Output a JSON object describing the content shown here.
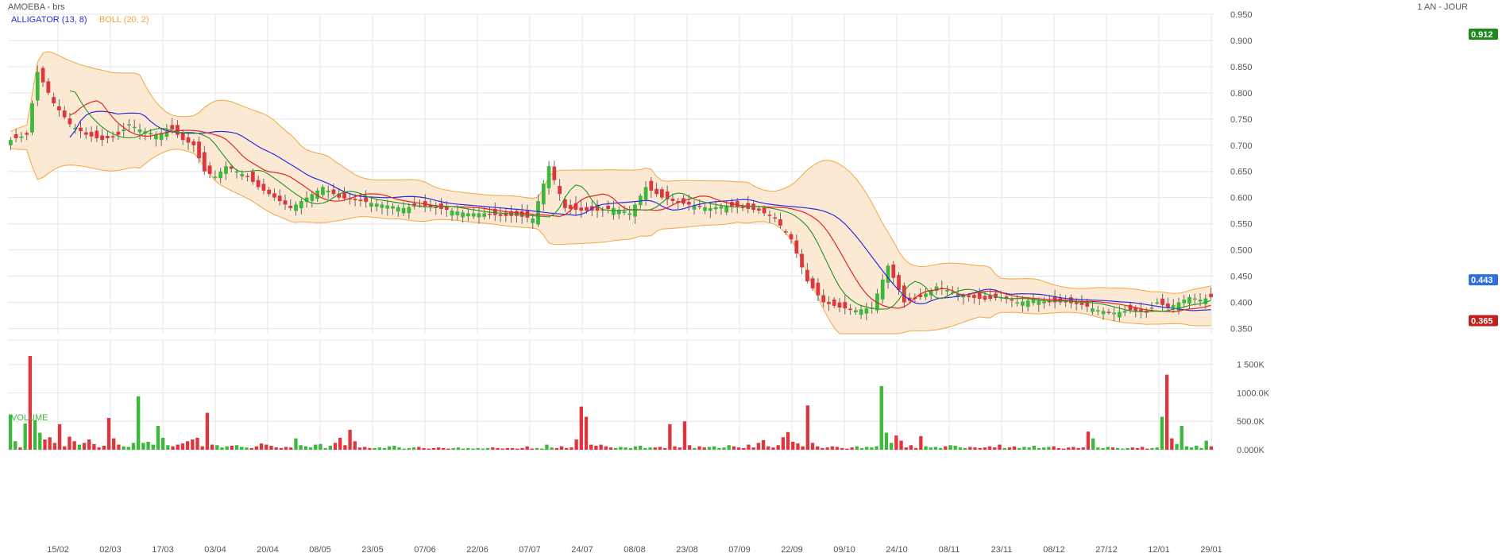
{
  "header": {
    "symbol": "AMOEBA - brs",
    "period": "1 AN - JOUR"
  },
  "indicators": {
    "alligator": "ALLIGATOR (13, 8)",
    "boll": "BOLL (20, 2)",
    "volume": "VOLUME"
  },
  "colors": {
    "up": "#3cb83c",
    "down": "#e0353f",
    "alligator_slow": "#2c2cdc",
    "alligator_mid": "#e02424",
    "alligator_fast": "#2e9a2e",
    "boll_line": "#f4a640",
    "boll_fill": "#fce5cc",
    "grid": "#e6e6e6",
    "badge_high": "#1e8a1e",
    "badge_last": "#2f6fe0",
    "badge_low": "#c41f1f"
  },
  "badges": {
    "high": "0.912",
    "last": "0.443",
    "low": "0.365"
  },
  "chart_data": [
    {
      "type": "candlestick",
      "title": "AMOEBA - brs",
      "ylim": [
        0.34,
        0.95
      ],
      "y_ticks": [
        "0.950",
        "0.900",
        "0.850",
        "0.800",
        "0.750",
        "0.700",
        "0.650",
        "0.600",
        "0.550",
        "0.500",
        "0.450",
        "0.400",
        "0.350"
      ],
      "x_ticks": [
        "15/02",
        "02/03",
        "17/03",
        "03/04",
        "20/04",
        "08/05",
        "23/05",
        "07/06",
        "22/06",
        "07/07",
        "24/07",
        "08/08",
        "23/08",
        "07/09",
        "22/09",
        "09/10",
        "24/10",
        "08/11",
        "23/11",
        "08/12",
        "27/12",
        "12/01",
        "29/01"
      ],
      "grid": true,
      "close_anchors": [
        [
          0,
          0.71
        ],
        [
          3,
          0.72
        ],
        [
          5,
          0.84
        ],
        [
          8,
          0.78
        ],
        [
          11,
          0.74
        ],
        [
          14,
          0.72
        ],
        [
          17,
          0.71
        ],
        [
          20,
          0.72
        ],
        [
          22,
          0.74
        ],
        [
          24,
          0.73
        ],
        [
          27,
          0.72
        ],
        [
          30,
          0.73
        ],
        [
          32,
          0.71
        ],
        [
          34,
          0.7
        ],
        [
          36,
          0.65
        ],
        [
          38,
          0.64
        ],
        [
          40,
          0.66
        ],
        [
          42,
          0.65
        ],
        [
          44,
          0.64
        ],
        [
          46,
          0.62
        ],
        [
          49,
          0.6
        ],
        [
          52,
          0.58
        ],
        [
          55,
          0.6
        ],
        [
          58,
          0.62
        ],
        [
          61,
          0.6
        ],
        [
          64,
          0.595
        ],
        [
          67,
          0.59
        ],
        [
          70,
          0.585
        ],
        [
          73,
          0.58
        ],
        [
          76,
          0.585
        ],
        [
          79,
          0.58
        ],
        [
          82,
          0.575
        ],
        [
          85,
          0.57
        ],
        [
          88,
          0.57
        ],
        [
          91,
          0.565
        ],
        [
          94,
          0.565
        ],
        [
          97,
          0.56
        ],
        [
          100,
          0.66
        ],
        [
          103,
          0.58
        ],
        [
          106,
          0.575
        ],
        [
          109,
          0.575
        ],
        [
          112,
          0.58
        ],
        [
          115,
          0.57
        ],
        [
          118,
          0.62
        ],
        [
          121,
          0.6
        ],
        [
          124,
          0.59
        ],
        [
          127,
          0.585
        ],
        [
          130,
          0.58
        ],
        [
          133,
          0.585
        ],
        [
          136,
          0.58
        ],
        [
          139,
          0.575
        ],
        [
          142,
          0.56
        ],
        [
          145,
          0.52
        ],
        [
          148,
          0.44
        ],
        [
          151,
          0.4
        ],
        [
          154,
          0.39
        ],
        [
          157,
          0.385
        ],
        [
          160,
          0.39
        ],
        [
          163,
          0.47
        ],
        [
          166,
          0.4
        ],
        [
          169,
          0.41
        ],
        [
          172,
          0.43
        ],
        [
          175,
          0.42
        ],
        [
          178,
          0.41
        ],
        [
          181,
          0.405
        ],
        [
          184,
          0.41
        ],
        [
          187,
          0.4
        ],
        [
          190,
          0.405
        ],
        [
          193,
          0.4
        ],
        [
          196,
          0.4
        ],
        [
          199,
          0.395
        ],
        [
          202,
          0.385
        ],
        [
          205,
          0.38
        ],
        [
          208,
          0.385
        ],
        [
          211,
          0.38
        ],
        [
          213,
          0.4
        ],
        [
          215,
          0.39
        ],
        [
          217,
          0.4
        ],
        [
          219,
          0.41
        ],
        [
          221,
          0.405
        ],
        [
          223,
          0.41
        ]
      ],
      "series": [
        {
          "name": "ALLIGATOR (13, 8)"
        },
        {
          "name": "BOLL (20, 2)"
        }
      ]
    },
    {
      "type": "bar",
      "title": "VOLUME",
      "ylim": [
        0,
        1650000
      ],
      "y_ticks": [
        "1 500K",
        "1000.0K",
        "500.0K",
        "0.000K"
      ],
      "values": [
        620000,
        150000,
        40000,
        460000,
        1650000,
        520000,
        300000,
        180000,
        220000,
        120000,
        450000,
        60000,
        230000,
        150000,
        90000,
        120000,
        180000,
        100000,
        40000,
        70000,
        560000,
        200000,
        90000,
        60000,
        50000,
        120000,
        940000,
        120000,
        140000,
        90000,
        420000,
        210000,
        80000,
        60000,
        90000,
        110000,
        150000,
        180000,
        210000,
        60000,
        650000,
        90000,
        80000,
        40000,
        60000,
        70000,
        80000,
        50000,
        40000,
        30000,
        60000,
        110000,
        90000,
        70000,
        40000,
        30000,
        50000,
        40000,
        200000,
        80000,
        60000,
        40000,
        90000,
        100000,
        30000,
        70000,
        120000,
        210000,
        80000,
        350000,
        150000,
        40000,
        50000,
        30000,
        30000,
        40000,
        30000,
        60000,
        70000,
        40000,
        20000,
        30000,
        40000,
        50000,
        30000,
        20000,
        30000,
        40000,
        30000,
        20000,
        30000,
        40000,
        20000,
        30000,
        20000,
        30000,
        20000,
        30000,
        40000,
        30000,
        20000,
        30000,
        30000,
        20000,
        30000,
        60000,
        20000,
        30000,
        20000,
        90000,
        40000,
        30000,
        60000,
        30000,
        40000,
        180000,
        760000,
        580000,
        90000,
        70000,
        90000,
        60000,
        40000,
        30000,
        50000,
        40000,
        30000,
        60000,
        70000,
        30000,
        40000,
        40000,
        50000,
        30000,
        450000,
        60000,
        40000,
        500000,
        80000,
        30000,
        60000,
        40000,
        50000,
        60000,
        30000,
        40000,
        80000,
        60000,
        40000,
        30000,
        90000,
        40000,
        120000,
        170000,
        60000,
        40000,
        80000,
        220000,
        310000,
        140000,
        110000,
        60000,
        780000,
        120000,
        60000,
        30000,
        40000,
        60000,
        50000,
        30000,
        20000,
        40000,
        60000,
        30000,
        50000,
        40000,
        60000,
        1120000,
        300000,
        120000,
        250000,
        160000,
        40000,
        80000,
        30000,
        240000,
        60000,
        40000,
        50000,
        30000,
        60000,
        80000,
        70000,
        40000,
        30000,
        50000,
        40000,
        30000,
        40000,
        60000,
        40000,
        90000,
        30000,
        40000,
        60000,
        30000,
        50000,
        40000,
        70000,
        30000,
        40000,
        50000,
        60000,
        30000,
        20000,
        40000,
        50000,
        30000,
        40000,
        320000,
        200000,
        40000,
        30000,
        50000,
        40000,
        30000,
        20000,
        30000,
        40000,
        30000,
        50000,
        20000,
        30000,
        40000,
        580000,
        1320000,
        200000,
        100000,
        420000,
        60000,
        40000,
        70000,
        30000,
        160000,
        60000
      ]
    }
  ]
}
